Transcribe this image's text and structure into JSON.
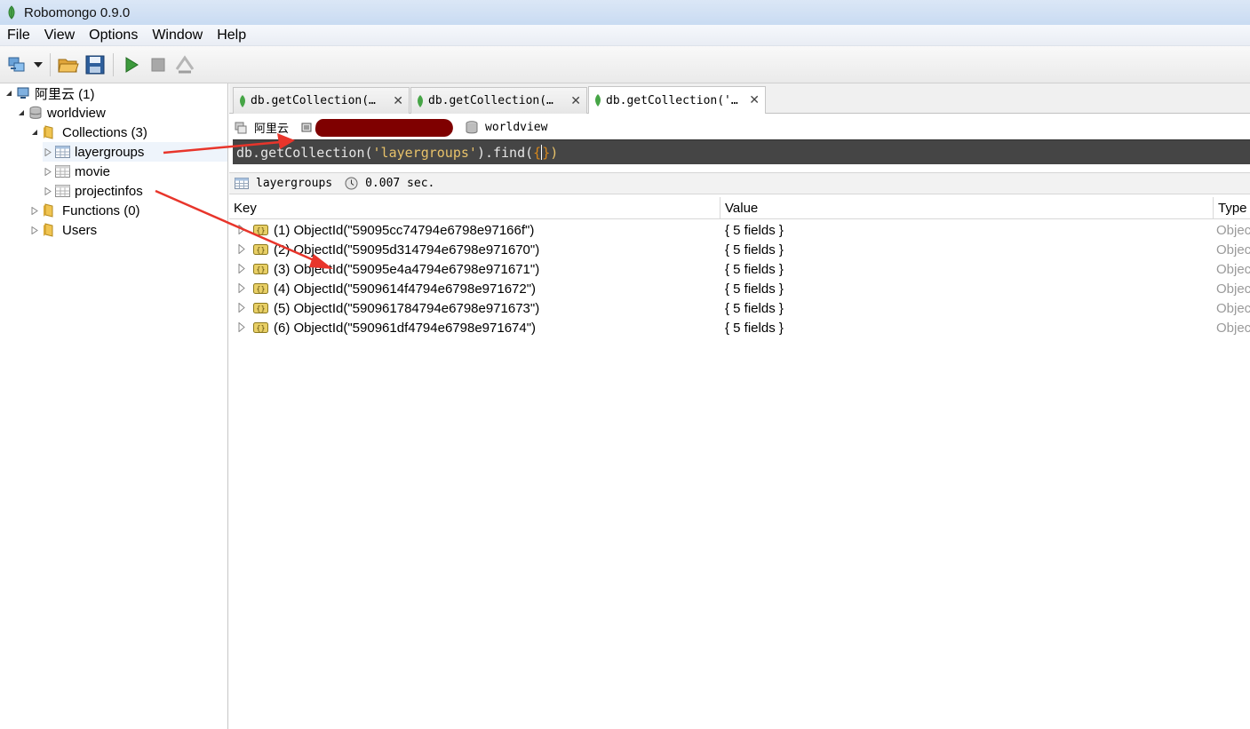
{
  "window": {
    "title": "Robomongo 0.9.0"
  },
  "menu": [
    "File",
    "View",
    "Options",
    "Window",
    "Help"
  ],
  "explorer": {
    "server": "阿里云 (1)",
    "database": "worldview",
    "collections_folder": "Collections (3)",
    "collections": [
      "layergroups",
      "movie",
      "projectinfos"
    ],
    "functions_folder": "Functions (0)",
    "users_folder": "Users"
  },
  "tabs": [
    {
      "label": "db.getCollection(…"
    },
    {
      "label": "db.getCollection(…"
    },
    {
      "label": "db.getCollection('…"
    }
  ],
  "query_info": {
    "server": "阿里云",
    "database": "worldview"
  },
  "editor": {
    "prefix": "db.getCollection(",
    "string": "'layergroups'",
    "middle": ").find(",
    "open_brace": "{",
    "close_brace": "}",
    "suffix": ")"
  },
  "result": {
    "collection": "layergroups",
    "time": "0.007 sec."
  },
  "grid": {
    "columns": [
      "Key",
      "Value",
      "Type"
    ],
    "rows": [
      {
        "key": "(1) ObjectId(\"59095cc74794e6798e97166f\")",
        "value": "{ 5 fields }",
        "type": "Object"
      },
      {
        "key": "(2) ObjectId(\"59095d314794e6798e971670\")",
        "value": "{ 5 fields }",
        "type": "Object"
      },
      {
        "key": "(3) ObjectId(\"59095e4a4794e6798e971671\")",
        "value": "{ 5 fields }",
        "type": "Object"
      },
      {
        "key": "(4) ObjectId(\"5909614f4794e6798e971672\")",
        "value": "{ 5 fields }",
        "type": "Object"
      },
      {
        "key": "(5) ObjectId(\"590961784794e6798e971673\")",
        "value": "{ 5 fields }",
        "type": "Object"
      },
      {
        "key": "(6) ObjectId(\"590961df4794e6798e971674\")",
        "value": "{ 5 fields }",
        "type": "Object"
      }
    ]
  },
  "colors": {
    "annotation_arrow": "#e8352b",
    "editor_bg": "#454545",
    "redaction": "#7f0000"
  }
}
